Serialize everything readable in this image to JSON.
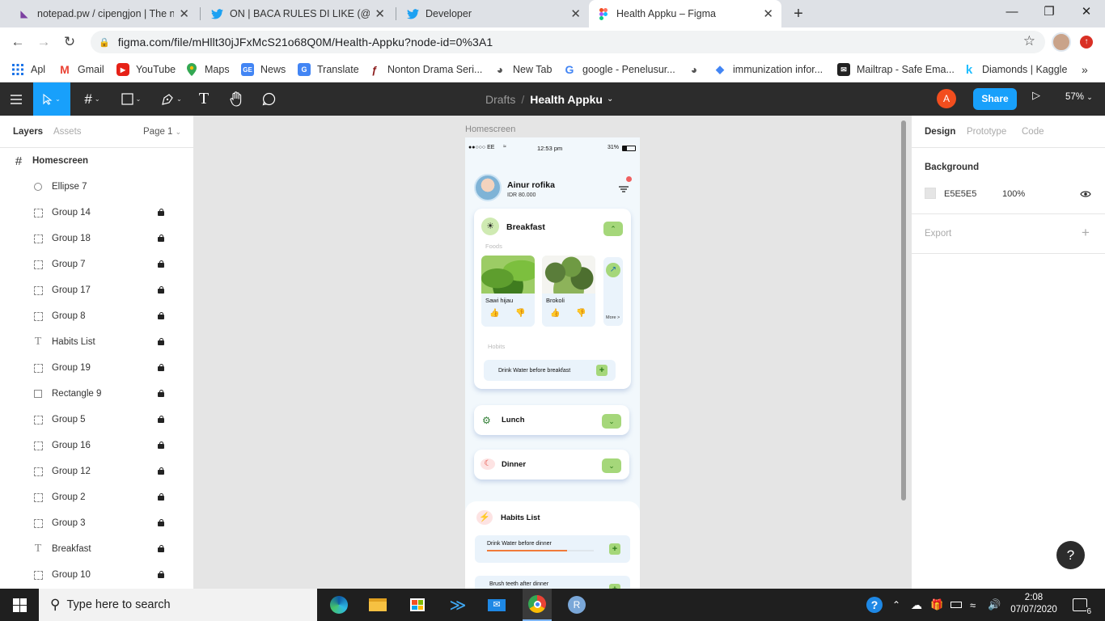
{
  "browser": {
    "tabs": [
      {
        "title": "notepad.pw / cipengjon | The na",
        "icon": "notepad-icon"
      },
      {
        "title": "ON | BACA RULES DI LIKE (@kdra",
        "icon": "twitter-icon"
      },
      {
        "title": "Developer",
        "icon": "twitter-icon"
      },
      {
        "title": "Health Appku – Figma",
        "icon": "figma-icon"
      }
    ],
    "new_tab": "+",
    "url": "figma.com/file/mHllt30jJFxMcS21o68Q0M/Health-Appku?node-id=0%3A1",
    "bookmarks": [
      {
        "label": "Apl",
        "icon": "apps-grid-icon"
      },
      {
        "label": "Gmail",
        "icon": "gmail-icon"
      },
      {
        "label": "YouTube",
        "icon": "youtube-icon"
      },
      {
        "label": "Maps",
        "icon": "maps-pin-icon"
      },
      {
        "label": "News",
        "icon": "news-icon"
      },
      {
        "label": "Translate",
        "icon": "translate-icon"
      },
      {
        "label": "Nonton Drama Seri...",
        "icon": "drama-icon"
      },
      {
        "label": "New Tab",
        "icon": "globe-icon"
      },
      {
        "label": "google - Penelusur...",
        "icon": "google-icon"
      },
      {
        "label": "",
        "icon": "globe-icon"
      },
      {
        "label": "immunization infor...",
        "icon": "diamond-icon"
      },
      {
        "label": "Mailtrap - Safe Ema...",
        "icon": "mailtrap-icon"
      },
      {
        "label": "Diamonds | Kaggle",
        "icon": "kaggle-icon"
      }
    ],
    "more_bookmarks": "»"
  },
  "figma": {
    "breadcrumb": {
      "drafts": "Drafts",
      "separator": "/",
      "project": "Health Appku"
    },
    "user_initial": "A",
    "share_label": "Share",
    "zoom": "57%",
    "left_tabs": {
      "layers": "Layers",
      "assets": "Assets",
      "page": "Page 1"
    },
    "layers": [
      {
        "name": "Homescreen",
        "type": "frame",
        "locked": false
      },
      {
        "name": "Ellipse 7",
        "type": "ellipse",
        "locked": false
      },
      {
        "name": "Group 14",
        "type": "group",
        "locked": true
      },
      {
        "name": "Group 18",
        "type": "group",
        "locked": true
      },
      {
        "name": "Group 7",
        "type": "group",
        "locked": true
      },
      {
        "name": "Group 17",
        "type": "group",
        "locked": true
      },
      {
        "name": "Group 8",
        "type": "group",
        "locked": true
      },
      {
        "name": "Habits List",
        "type": "text",
        "locked": true
      },
      {
        "name": "Group 19",
        "type": "group",
        "locked": true
      },
      {
        "name": "Rectangle 9",
        "type": "rect",
        "locked": true
      },
      {
        "name": "Group 5",
        "type": "group",
        "locked": true
      },
      {
        "name": "Group 16",
        "type": "group",
        "locked": true
      },
      {
        "name": "Group 12",
        "type": "group",
        "locked": true
      },
      {
        "name": "Group 2",
        "type": "group",
        "locked": true
      },
      {
        "name": "Group 3",
        "type": "group",
        "locked": true
      },
      {
        "name": "Breakfast",
        "type": "text",
        "locked": true
      },
      {
        "name": "Group 10",
        "type": "group",
        "locked": true
      }
    ],
    "right_tabs": {
      "design": "Design",
      "prototype": "Prototype",
      "code": "Code"
    },
    "background": {
      "title": "Background",
      "color_hex": "E5E5E5",
      "opacity": "100%"
    },
    "export_label": "Export",
    "help": "?"
  },
  "frame": {
    "label": "Homescreen",
    "status": {
      "carrier": "●●○○○ EE",
      "time": "12:53 pm",
      "battery": "31%"
    },
    "user": {
      "name": "Ainur rofika",
      "balance": "IDR 80.000"
    },
    "breakfast": {
      "title": "Breakfast",
      "foods_label": "Foods",
      "foods": [
        {
          "name": "Sawi hijau"
        },
        {
          "name": "Brokoli"
        }
      ],
      "more": "More >",
      "habits_label": "Hobits",
      "habit": "Drink Water before breakfast"
    },
    "lunch": {
      "title": "Lunch"
    },
    "dinner": {
      "title": "Dinner"
    },
    "habits_list": {
      "title": "Habits List",
      "items": [
        {
          "label": "Drink Water before dinner",
          "progress": 0.75
        },
        {
          "label": "Brush teeth after dinner"
        }
      ]
    }
  },
  "taskbar": {
    "search_placeholder": "Type here to search",
    "time": "2:08",
    "date": "07/07/2020",
    "notifications": "6"
  },
  "colors": {
    "figma_blue": "#18a0fb",
    "avatar_orange": "#f24e1e",
    "accent_green": "#a5d77a",
    "canvas": "#e5e5e5"
  }
}
